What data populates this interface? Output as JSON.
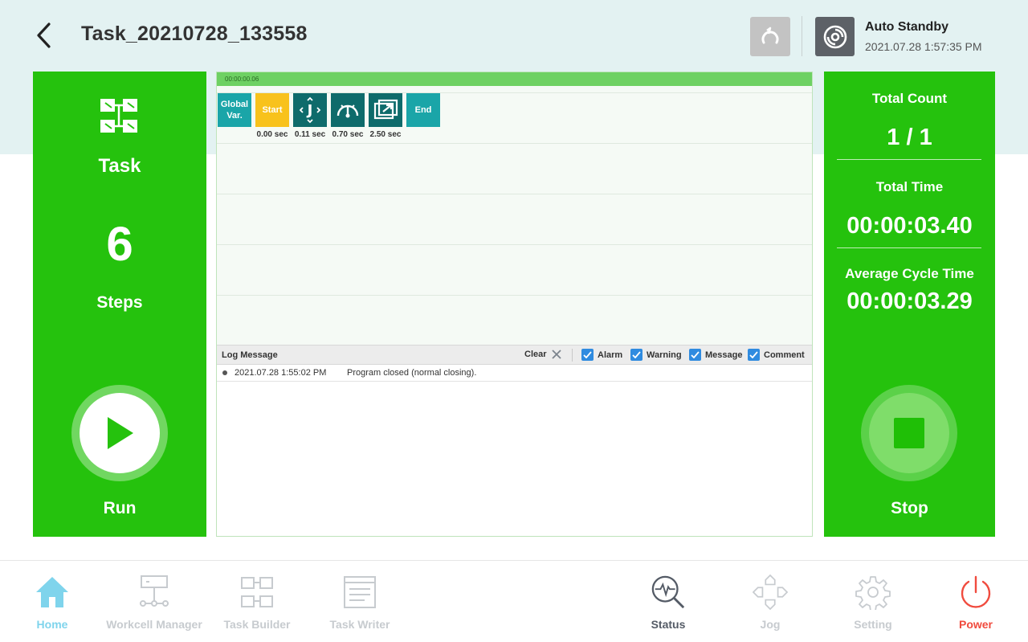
{
  "header": {
    "title": "Task_20210728_133558",
    "status_title": "Auto Standby",
    "status_time": "2021.07.28 1:57:35 PM"
  },
  "left_panel": {
    "task_label": "Task",
    "steps_count": "6",
    "steps_label": "Steps",
    "run_label": "Run"
  },
  "timeline": {
    "progress_time": "00:00:00.06",
    "blocks": [
      {
        "label": "Global Var.",
        "time": "",
        "color": "#1aa5a8",
        "icon": "global-var"
      },
      {
        "label": "Start",
        "time": "0.00 sec",
        "color": "#f8c21c",
        "icon": "start"
      },
      {
        "label": "",
        "time": "0.11 sec",
        "color": "#0e6b6b",
        "icon": "move-j-icon"
      },
      {
        "label": "",
        "time": "0.70 sec",
        "color": "#0e6b6b",
        "icon": "gauge-icon"
      },
      {
        "label": "",
        "time": "2.50 sec",
        "color": "#0e6b6b",
        "icon": "image-icon"
      },
      {
        "label": "End",
        "time": "",
        "color": "#1aa5a8",
        "icon": "end"
      }
    ]
  },
  "log": {
    "title": "Log Message",
    "clear_label": "Clear",
    "filters": [
      {
        "label": "Alarm",
        "checked": true
      },
      {
        "label": "Warning",
        "checked": true
      },
      {
        "label": "Message",
        "checked": true
      },
      {
        "label": "Comment",
        "checked": true
      }
    ],
    "entries": [
      {
        "time": "2021.07.28 1:55:02 PM",
        "message": "Program closed (normal closing)."
      }
    ]
  },
  "right_panel": {
    "total_count_label": "Total Count",
    "total_count_value": "1 / 1",
    "total_time_label": "Total Time",
    "total_time_value": "00:00:03.40",
    "avg_cycle_label": "Average Cycle Time",
    "avg_cycle_value": "00:00:03.29",
    "stop_label": "Stop"
  },
  "nav": {
    "items": [
      {
        "label": "Home",
        "active": true,
        "color": "#7fd4ec"
      },
      {
        "label": "Workcell Manager",
        "active": false,
        "color": "#c7cbcf"
      },
      {
        "label": "Task Builder",
        "active": false,
        "color": "#c7cbcf"
      },
      {
        "label": "Task Writer",
        "active": false,
        "color": "#c7cbcf"
      },
      {
        "label": "Status",
        "active": false,
        "color": "#545b66"
      },
      {
        "label": "Jog",
        "active": false,
        "color": "#c7cbcf"
      },
      {
        "label": "Setting",
        "active": false,
        "color": "#c7cbcf"
      },
      {
        "label": "Power",
        "active": false,
        "color": "#f04b3e"
      }
    ]
  },
  "colors": {
    "accent_green": "#25c20d",
    "progress_green": "#6ed163",
    "checkbox_blue": "#2f8be0",
    "teal_block": "#0e6b6b",
    "start_yellow": "#f8c21c"
  }
}
